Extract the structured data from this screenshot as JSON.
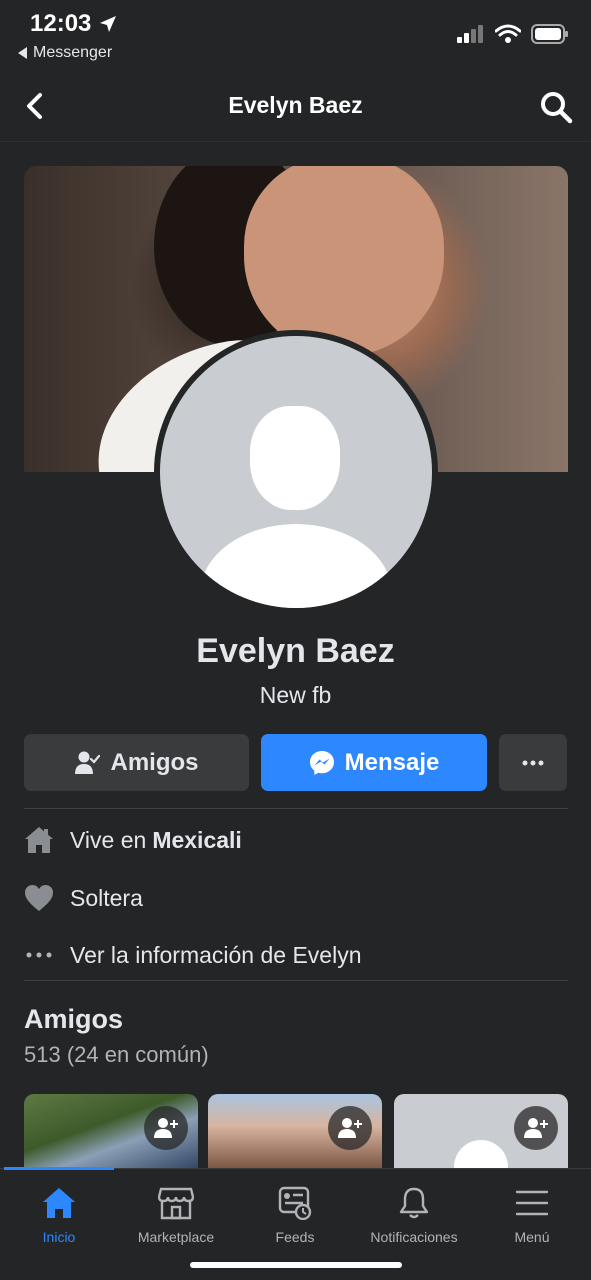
{
  "status_bar": {
    "time": "12:03",
    "back_app": "Messenger"
  },
  "nav": {
    "title": "Evelyn Baez"
  },
  "profile": {
    "name": "Evelyn Baez",
    "bio": "New fb",
    "buttons": {
      "friends": "Amigos",
      "message": "Mensaje"
    }
  },
  "info": {
    "lives_prefix": "Vive en",
    "lives_city": "Mexicali",
    "relationship": "Soltera",
    "see_info": "Ver la información de Evelyn"
  },
  "friends_section": {
    "title": "Amigos",
    "count": "513 (24 en común)"
  },
  "tabs": [
    {
      "label": "Inicio",
      "icon": "home-icon",
      "active": true
    },
    {
      "label": "Marketplace",
      "icon": "marketplace-icon"
    },
    {
      "label": "Feeds",
      "icon": "feeds-icon"
    },
    {
      "label": "Notificaciones",
      "icon": "bell-icon"
    },
    {
      "label": "Menú",
      "icon": "menu-icon"
    }
  ],
  "colors": {
    "accent": "#2d88ff",
    "background": "#242526",
    "button": "#3a3b3c"
  }
}
